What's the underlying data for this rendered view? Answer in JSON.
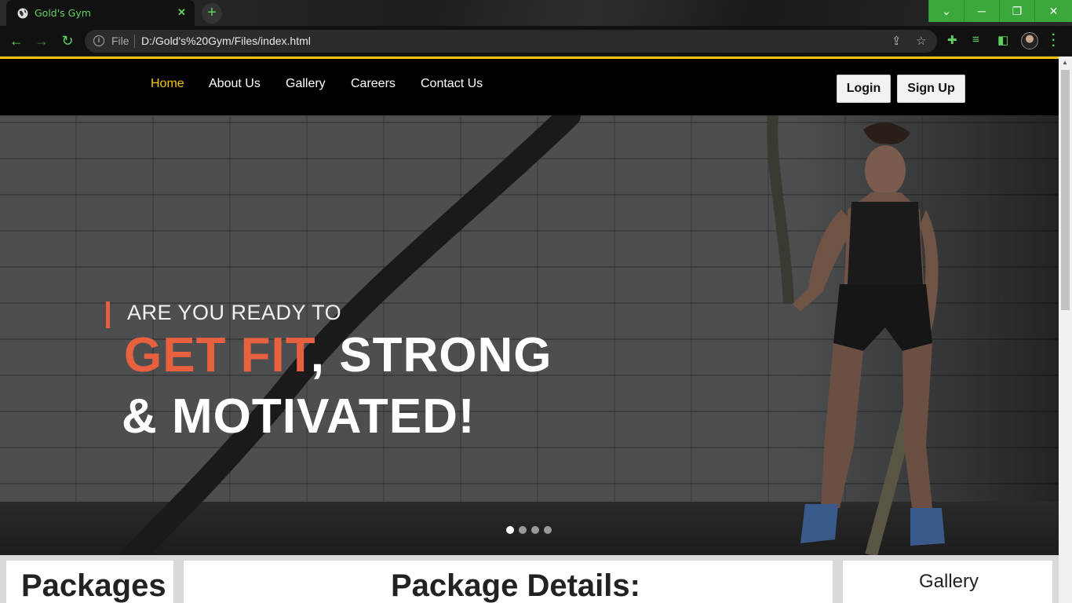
{
  "browser": {
    "tab_title": "Gold's Gym",
    "tab_close": "✕",
    "new_tab": "+",
    "url_scheme": "File",
    "url": "D:/Gold's%20Gym/Files/index.html",
    "window_controls": {
      "tab_search": "⌄",
      "minimize": "─",
      "restore": "❐",
      "close": "✕"
    },
    "nav": {
      "back": "←",
      "forward": "→",
      "reload": "↻"
    },
    "accent_color": "#5fd35f"
  },
  "site": {
    "nav": {
      "links": [
        "Home",
        "About Us",
        "Gallery",
        "Careers",
        "Contact Us"
      ],
      "active": "Home",
      "login": "Login",
      "signup": "Sign Up"
    },
    "hero": {
      "line1": "ARE YOU READY TO",
      "line2_accent": "GET FIT",
      "line2_rest": ", STRONG",
      "line3": "& MOTIVATED!",
      "slides": 4,
      "active_slide": 1
    },
    "sections": {
      "packages_title": "Packages",
      "details_title": "Package Details:",
      "gallery_title": "Gallery"
    },
    "colors": {
      "nav_active": "#f5c400",
      "accent": "#e8613f",
      "top_line": "#f5c400"
    }
  }
}
